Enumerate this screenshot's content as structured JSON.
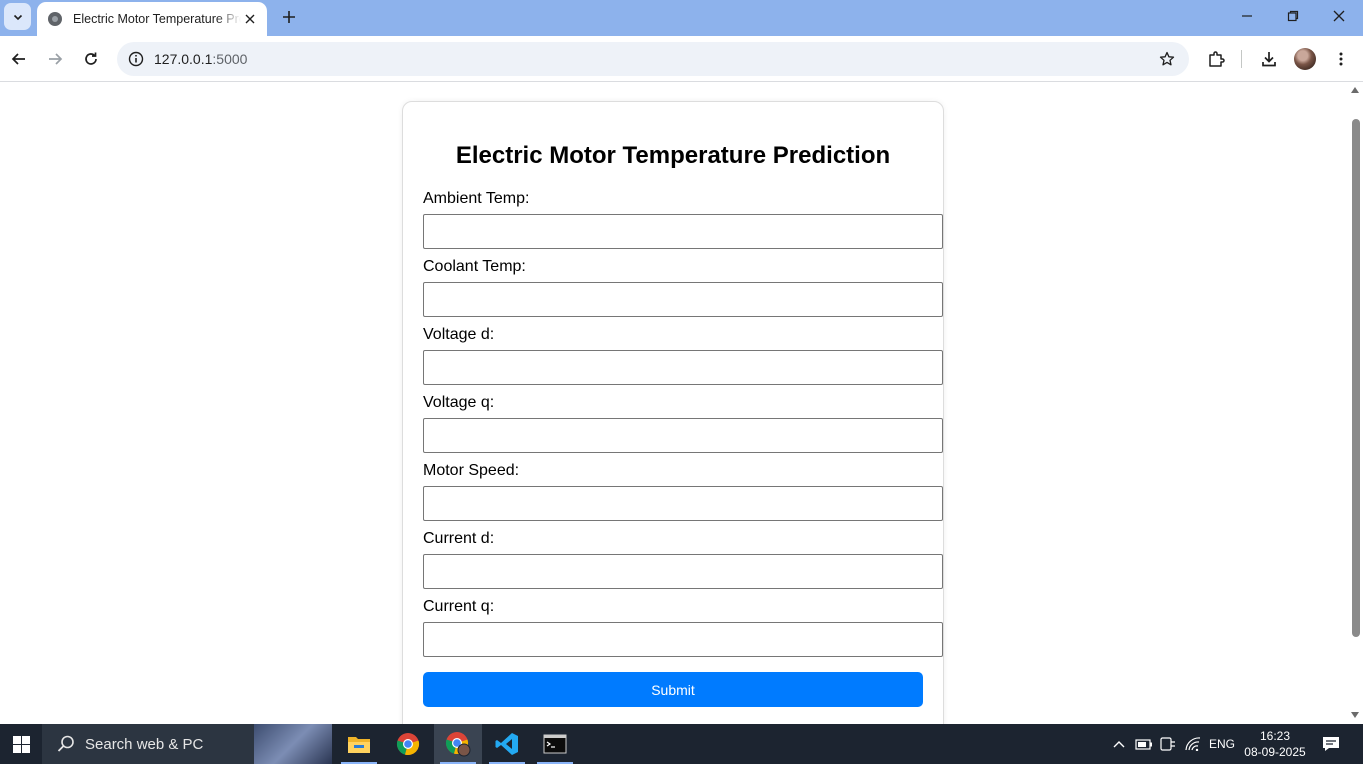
{
  "browser": {
    "tab_title": "Electric Motor Temperature Prediction",
    "url_host": "127.0.0.1",
    "url_port": ":5000"
  },
  "page": {
    "title": "Electric Motor Temperature Prediction",
    "fields": [
      {
        "label": "Ambient Temp:",
        "value": ""
      },
      {
        "label": "Coolant Temp:",
        "value": ""
      },
      {
        "label": "Voltage d:",
        "value": ""
      },
      {
        "label": "Voltage q:",
        "value": ""
      },
      {
        "label": "Motor Speed:",
        "value": ""
      },
      {
        "label": "Current d:",
        "value": ""
      },
      {
        "label": "Current q:",
        "value": ""
      }
    ],
    "submit_label": "Submit",
    "accent_color": "#007bff"
  },
  "taskbar": {
    "search_text": "Search web & PC",
    "language": "ENG",
    "time": "16:23",
    "date": "08-09-2025",
    "apps": [
      "file-explorer-icon",
      "chrome-icon",
      "chrome-profile-icon",
      "vscode-icon",
      "terminal-icon"
    ]
  }
}
